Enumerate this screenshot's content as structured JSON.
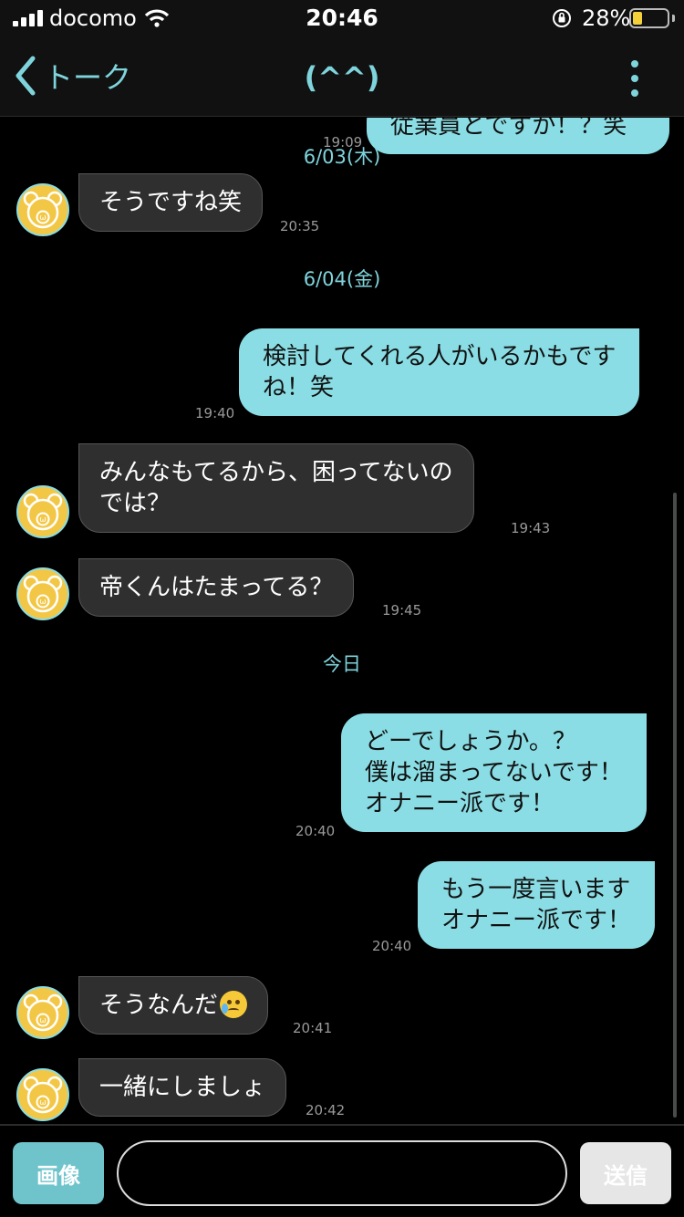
{
  "status_bar": {
    "carrier": "docomo",
    "time": "20:46",
    "battery_percent": "28%",
    "battery_level": 0.28
  },
  "header": {
    "back_label": "トーク",
    "title": "(^^)"
  },
  "colors": {
    "accent": "#7fd4dc",
    "outgoing_bubble": "#8adde4",
    "incoming_bubble": "#2f2f2f",
    "avatar": "#f3c746",
    "background": "#000000"
  },
  "messages": [
    {
      "dir": "out",
      "text": "従業員とですか！？笑",
      "time": "19:09"
    },
    {
      "dir": "date",
      "text": "6/03(木)"
    },
    {
      "dir": "in",
      "text": "そうですね笑",
      "time": "20:35"
    },
    {
      "dir": "date",
      "text": "6/04(金)"
    },
    {
      "dir": "out",
      "lines": [
        "検討してくれる人がいるかもです",
        "ね！笑"
      ],
      "time": "19:40"
    },
    {
      "dir": "in",
      "lines": [
        "みんなもてるから、困ってないの",
        "では？"
      ],
      "time": "19:43"
    },
    {
      "dir": "in",
      "text": "帝くんはたまってる？",
      "time": "19:45"
    },
    {
      "dir": "date",
      "text": "今日"
    },
    {
      "dir": "out",
      "lines": [
        "どーでしょうか。？",
        "僕は溜まってないです！",
        "オナニー派です！"
      ],
      "time": "20:40"
    },
    {
      "dir": "out",
      "lines": [
        "もう一度言います",
        "オナニー派です！"
      ],
      "time": "20:40"
    },
    {
      "dir": "in",
      "text": "そうなんだ",
      "emoji": "crying-face",
      "time": "20:41"
    },
    {
      "dir": "in",
      "text": "一緒にしましょ",
      "time": "20:42"
    }
  ],
  "input_bar": {
    "image_button": "画像",
    "input_value": "",
    "send_button": "送信"
  }
}
